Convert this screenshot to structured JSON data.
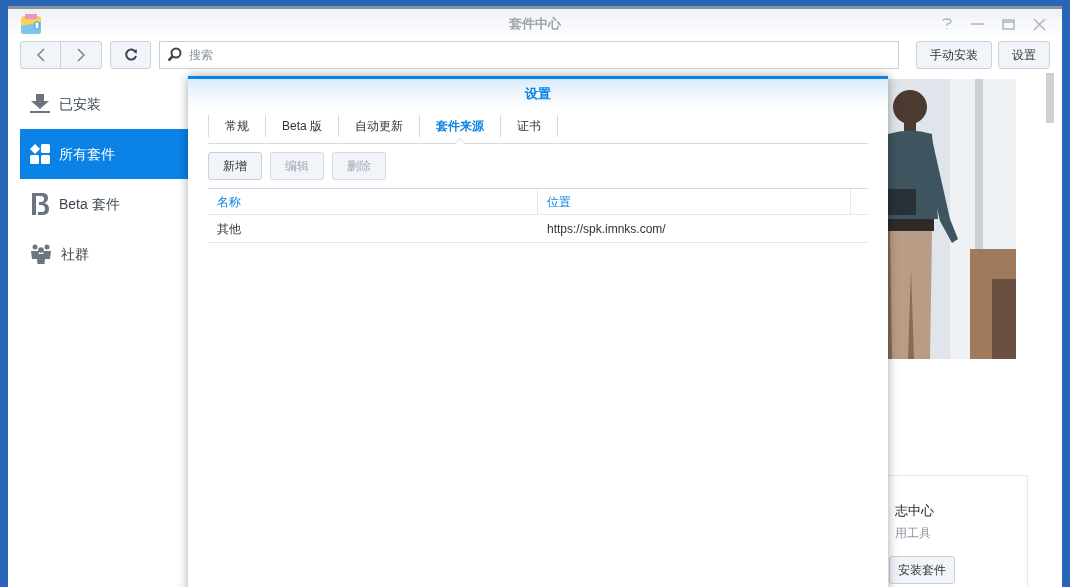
{
  "window": {
    "title": "套件中心"
  },
  "toolbar": {
    "search": {
      "placeholder": "搜索"
    },
    "buttons": [
      "手动安装",
      "设置"
    ]
  },
  "sidebar": {
    "items": [
      {
        "label": "已安装",
        "selected": false
      },
      {
        "label": "所有套件",
        "selected": true
      },
      {
        "label": "Beta 套件",
        "selected": false
      },
      {
        "label": "社群",
        "selected": false
      }
    ]
  },
  "background_card": {
    "title": "志中心",
    "subtitle": "用工具",
    "button": "安装套件"
  },
  "dialog": {
    "title": "设置",
    "tabs": [
      {
        "label": "常规",
        "selected": false
      },
      {
        "label": "Beta 版",
        "selected": false
      },
      {
        "label": "自动更新",
        "selected": false
      },
      {
        "label": "套件来源",
        "selected": true
      },
      {
        "label": "证书",
        "selected": false
      }
    ],
    "buttons": [
      {
        "label": "新增",
        "disabled": false
      },
      {
        "label": "编辑",
        "disabled": true
      },
      {
        "label": "删除",
        "disabled": true
      }
    ],
    "table": {
      "columns": [
        "名称",
        "位置"
      ],
      "rows": [
        [
          "其他",
          "https://spk.imnks.com/"
        ]
      ]
    }
  }
}
